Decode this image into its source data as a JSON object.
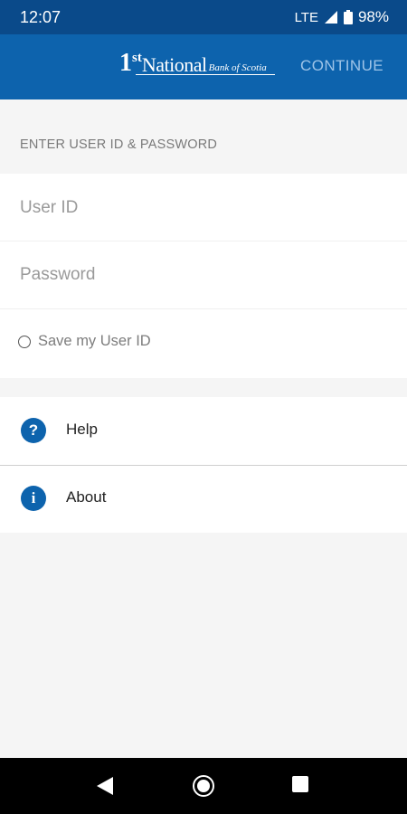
{
  "status_bar": {
    "time": "12:07",
    "network": "LTE",
    "battery": "98%"
  },
  "header": {
    "logo": {
      "one": "1",
      "st": "st",
      "national": "National",
      "bank": "Bank of Scotia"
    },
    "continue_label": "CONTINUE"
  },
  "login": {
    "section_title": "ENTER USER ID & PASSWORD",
    "userid_placeholder": "User ID",
    "password_placeholder": "Password",
    "save_label": "Save my User ID"
  },
  "menu": {
    "items": [
      {
        "icon": "?",
        "label": "Help"
      },
      {
        "icon": "i",
        "label": "About"
      }
    ]
  },
  "colors": {
    "status_bar": "#0a4a8a",
    "app_bar": "#0d63ad",
    "accent": "#0d63ad",
    "continue_text": "#9ec4e8"
  }
}
